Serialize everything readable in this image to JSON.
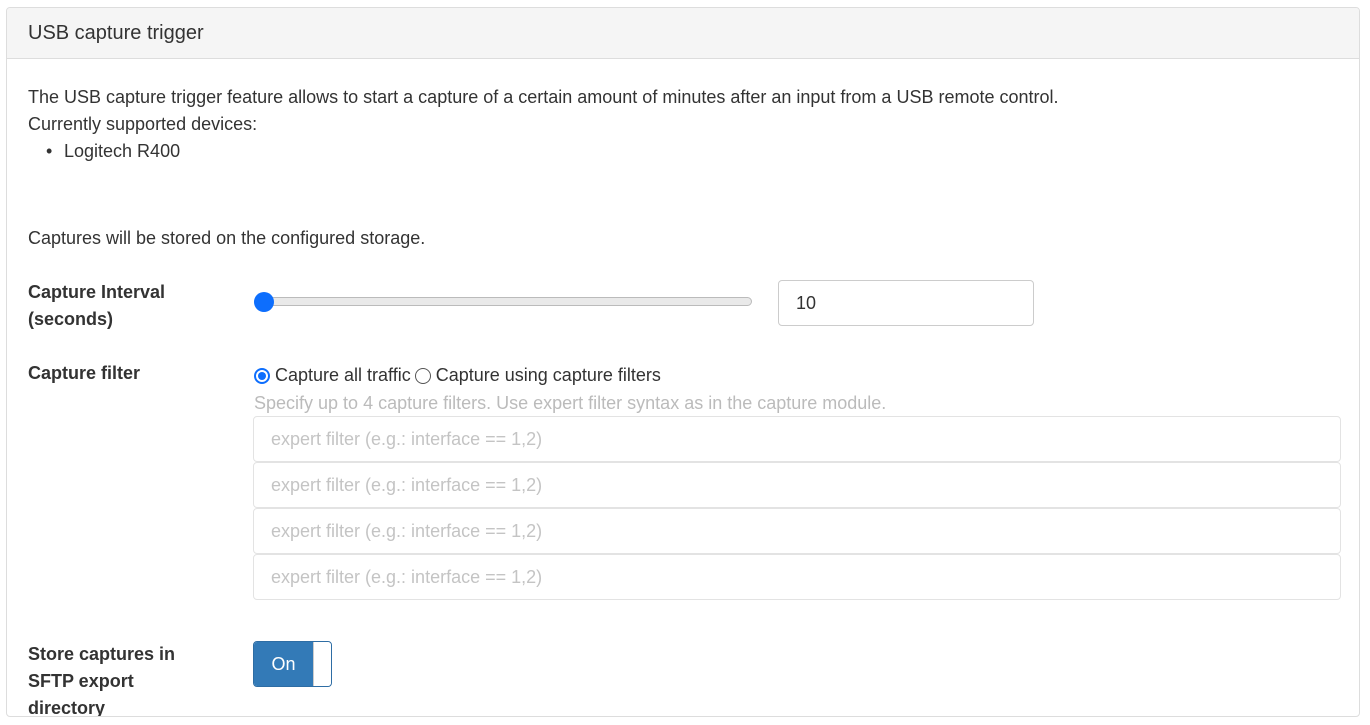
{
  "panel": {
    "title": "USB capture trigger"
  },
  "description": {
    "line1": "The USB capture trigger feature allows to start a capture of a certain amount of minutes after an input from a USB remote control.",
    "line2": "Currently supported devices:",
    "devices": [
      "Logitech R400"
    ],
    "storage_note": "Captures will be stored on the configured storage."
  },
  "capture_interval": {
    "label": "Capture Interval (seconds)",
    "value": "10",
    "slider_fraction": 0.0
  },
  "capture_filter": {
    "label": "Capture filter",
    "options": [
      {
        "label": "Capture all traffic",
        "checked": true
      },
      {
        "label": "Capture using capture filters",
        "checked": false
      }
    ],
    "help": "Specify up to 4 capture filters. Use expert filter syntax as in the capture module.",
    "inputs": [
      {
        "placeholder": "expert filter (e.g.: interface == 1,2)"
      },
      {
        "placeholder": "expert filter (e.g.: interface == 1,2)"
      },
      {
        "placeholder": "expert filter (e.g.: interface == 1,2)"
      },
      {
        "placeholder": "expert filter (e.g.: interface == 1,2)"
      }
    ]
  },
  "sftp_export": {
    "label": "Store captures in SFTP export directory",
    "toggle_label": "On",
    "enabled": true
  },
  "colors": {
    "accent": "#0d6efd",
    "toggle_on": "#337ab7"
  }
}
